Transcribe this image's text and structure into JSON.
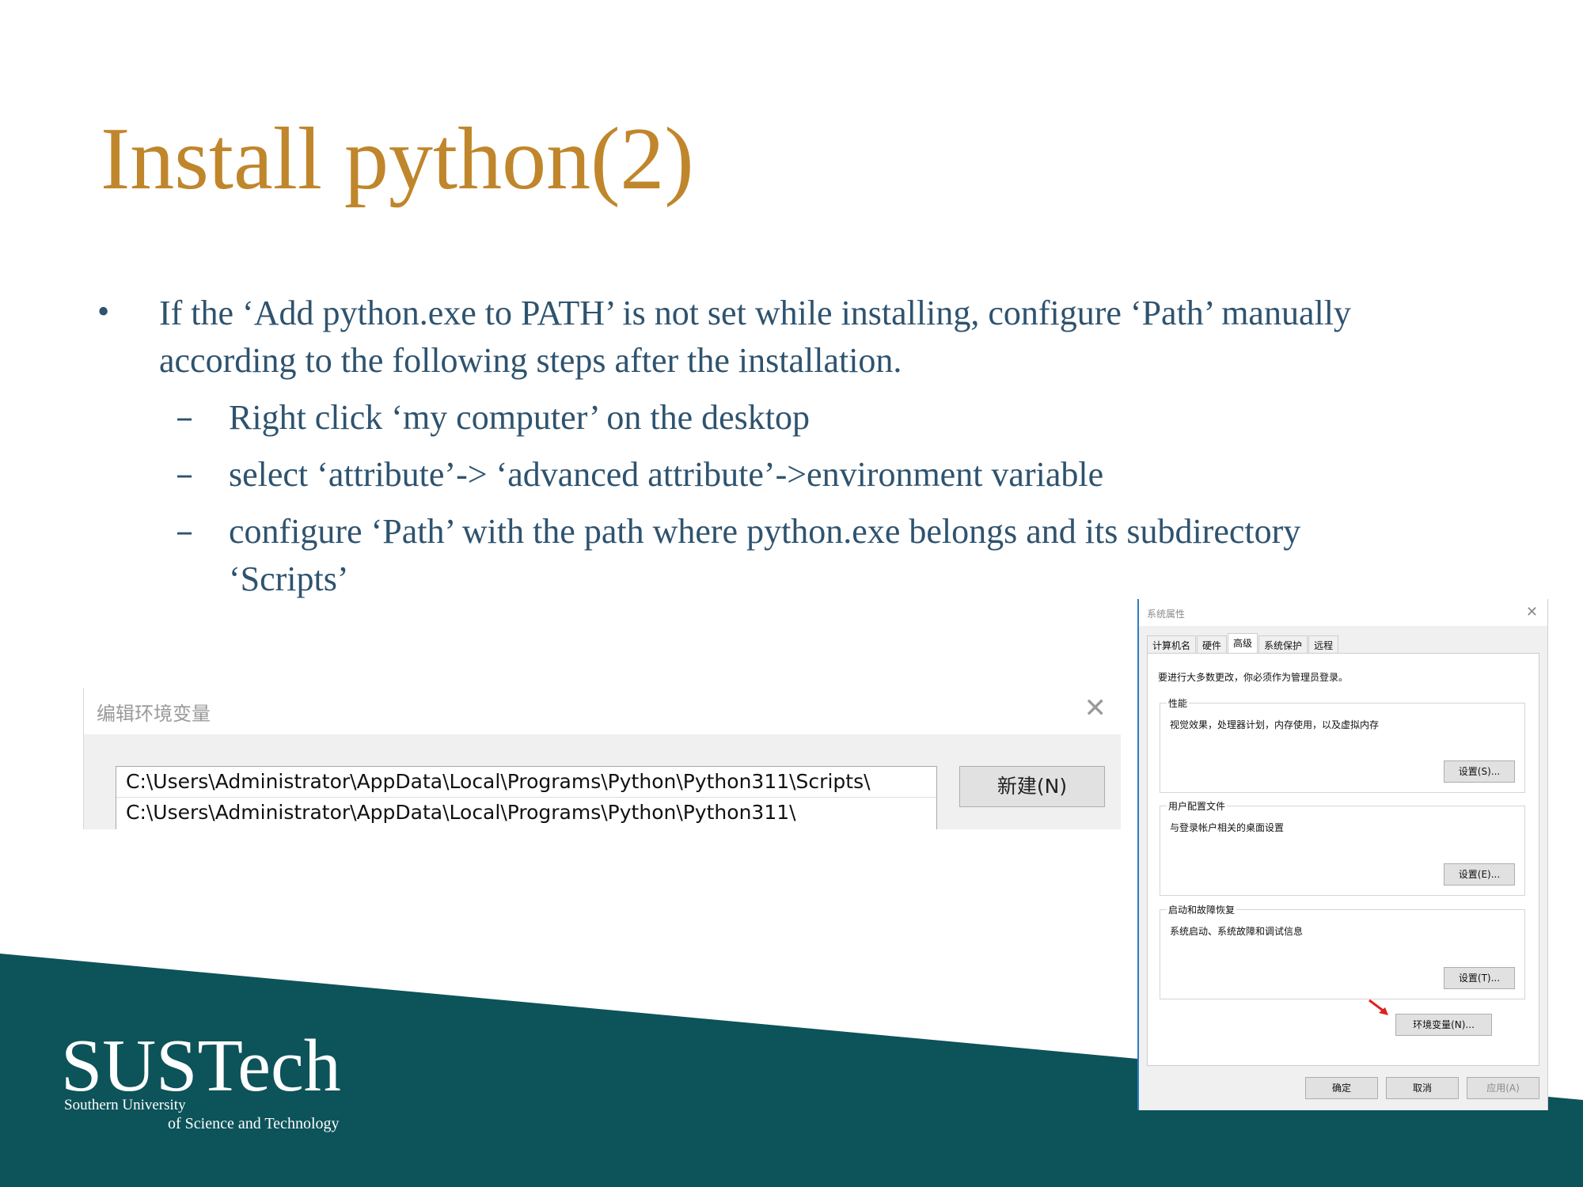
{
  "slide": {
    "title": "Install python(2)",
    "bullet_main_symbol": "•",
    "bullet_main_text": "If the ‘Add python.exe to PATH’ is not set while installing, configure ‘Path’ manually according to the following steps after the installation.",
    "sub_symbol": "–",
    "sub_bullets": [
      "Right click ‘my computer’ on the desktop",
      "select ‘attribute’-> ‘advanced attribute’->environment variable",
      "configure ‘Path’ with the path where python.exe belongs and its subdirectory ‘Scripts’"
    ]
  },
  "env_dialog": {
    "title": "编辑环境变量",
    "close_glyph": "✕",
    "paths": [
      "C:\\Users\\Administrator\\AppData\\Local\\Programs\\Python\\Python311\\Scripts\\",
      "C:\\Users\\Administrator\\AppData\\Local\\Programs\\Python\\Python311\\"
    ],
    "new_button": "新建(N)"
  },
  "sys_dialog": {
    "title": "系统属性",
    "close_glyph": "✕",
    "tabs": [
      "计算机名",
      "硬件",
      "高级",
      "系统保护",
      "远程"
    ],
    "active_tab": "高级",
    "admin_note": "要进行大多数更改，你必须作为管理员登录。",
    "groups": [
      {
        "label": "性能",
        "desc": "视觉效果，处理器计划，内存使用，以及虚拟内存",
        "button": "设置(S)..."
      },
      {
        "label": "用户配置文件",
        "desc": "与登录帐户相关的桌面设置",
        "button": "设置(E)..."
      },
      {
        "label": "启动和故障恢复",
        "desc": "系统启动、系统故障和调试信息",
        "button": "设置(T)..."
      }
    ],
    "env_button": "环境变量(N)...",
    "ok_button": "确定",
    "cancel_button": "取消",
    "apply_button": "应用(A)"
  },
  "logo": {
    "name": "SUSTech",
    "line1": "Southern University",
    "line2": "of Science and Technology"
  },
  "colors": {
    "title": "#c0862b",
    "body_text": "#2e536f",
    "band": "#0d535a",
    "arrow": "#e02020"
  }
}
